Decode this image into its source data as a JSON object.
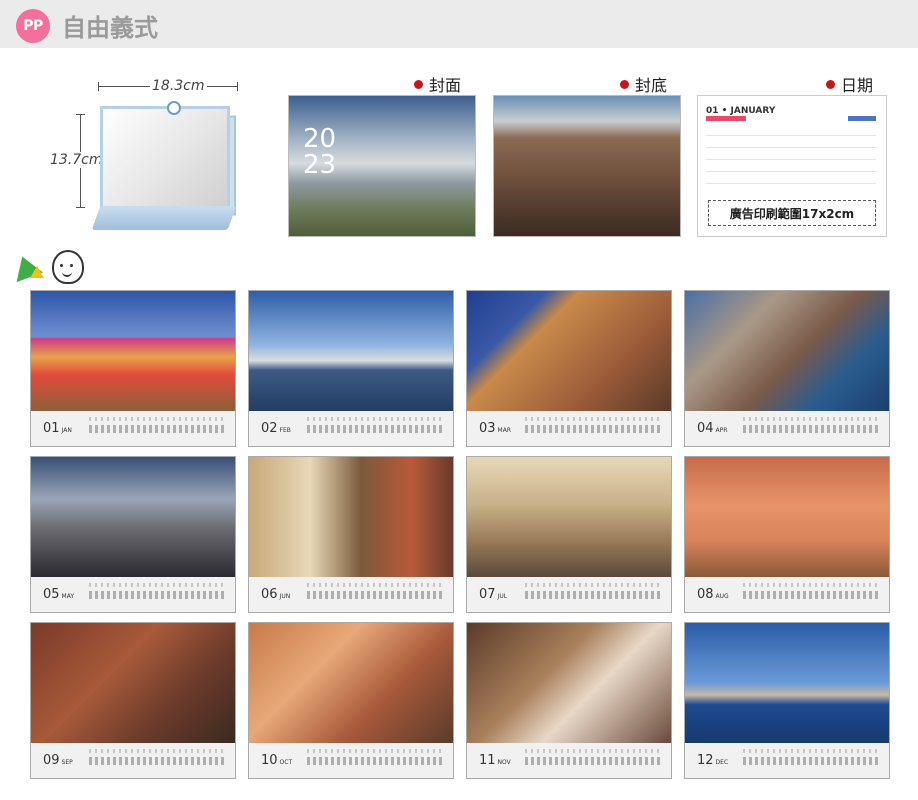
{
  "header": {
    "badge": "PP",
    "title": "自由義式"
  },
  "stand": {
    "width_label": "18.3cm",
    "height_label": "13.7cm"
  },
  "labels": {
    "cover": "封面",
    "back": "封底",
    "date": "日期"
  },
  "cover": {
    "year_line1": "20",
    "year_line2": "23"
  },
  "date_preview": {
    "month_heading": "01 • JANUARY",
    "print_area": "廣告印刷範圍17x2cm",
    "accent_colors": {
      "left": "#e84a6a",
      "right": "#4a76c4"
    }
  },
  "months": [
    {
      "num": "01",
      "abbr": "JAN"
    },
    {
      "num": "02",
      "abbr": "FEB"
    },
    {
      "num": "03",
      "abbr": "MAR"
    },
    {
      "num": "04",
      "abbr": "APR"
    },
    {
      "num": "05",
      "abbr": "MAY"
    },
    {
      "num": "06",
      "abbr": "JUN"
    },
    {
      "num": "07",
      "abbr": "JUL"
    },
    {
      "num": "08",
      "abbr": "AUG"
    },
    {
      "num": "09",
      "abbr": "SEP"
    },
    {
      "num": "10",
      "abbr": "OCT"
    },
    {
      "num": "11",
      "abbr": "NOV"
    },
    {
      "num": "12",
      "abbr": "DEC"
    }
  ],
  "colors": {
    "badge": "#f2709b",
    "header_bg": "#ebebeb",
    "dot": "#c4161c"
  }
}
